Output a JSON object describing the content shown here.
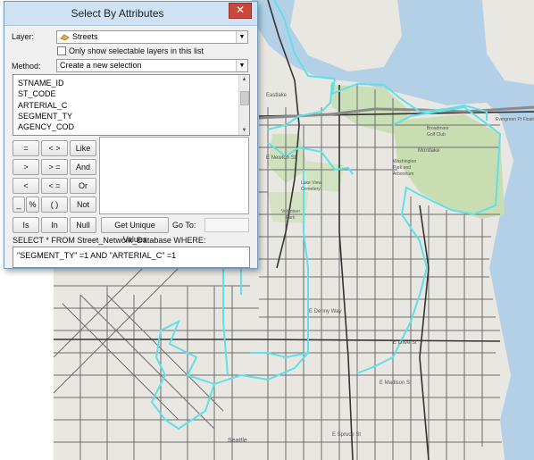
{
  "dialog": {
    "title": "Select By Attributes",
    "close_glyph": "✕",
    "layer_label": "Layer:",
    "layer_value": "Streets",
    "layer_icon": "layer-icon",
    "selectable_only_label": "Only show selectable layers in this list",
    "selectable_only_checked": false,
    "method_label": "Method:",
    "method_value": "Create a new selection",
    "fields": [
      "STNAME_ID",
      "ST_CODE",
      "ARTERIAL_C",
      "SEGMENT_TY",
      "AGENCY_COD"
    ],
    "operators": [
      "=",
      "< >",
      "Like",
      ">",
      "> =",
      "And",
      "<",
      "< =",
      "Or",
      "_",
      "%",
      "( )",
      "Not",
      "Is",
      "In",
      "Null"
    ],
    "unique_values_label": "Get Unique Values",
    "goto_label": "Go To:",
    "query_prefix": "SELECT * FROM Street_Network_Database WHERE:",
    "query_text": "\"SEGMENT_TY\" =1 AND \"ARTERIAL_C\" =1"
  },
  "map": {
    "labels": [
      "Eastlake",
      "Montlake",
      "Broadmoor Golf Club",
      "Washington Park and Arboretum",
      "E Newton St",
      "Volunteer Park",
      "Lake View Cemetery",
      "E Denny Way",
      "E Olive St",
      "E Madison St",
      "E Spruce St",
      "Seattle",
      "Evergreen Pt Floating Brg"
    ],
    "colors": {
      "water": "#b3d0e6",
      "land": "#e8e6e1",
      "park": "#c6dcb0",
      "roads": "#4a4a4a",
      "highlight": "#5fe0e8"
    }
  }
}
